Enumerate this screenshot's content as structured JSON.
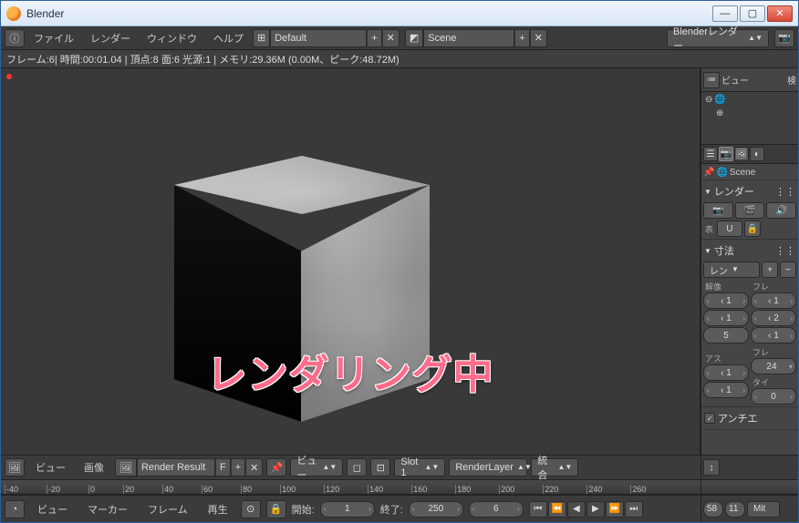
{
  "window": {
    "title": "Blender"
  },
  "menubar": {
    "items": [
      "ファイル",
      "レンダー",
      "ウィンドウ",
      "ヘルプ"
    ],
    "layout_field": "Default",
    "scene_field": "Scene",
    "engine": "Blenderレンダー"
  },
  "info_strip": "フレーム:6| 時間:00:01.04 | 頂点:8 面:6 光源:1 | メモリ:29.36M (0.00M、ピーク:48.72M)",
  "overlay": "レンダリング中",
  "image_editor": {
    "view": "ビュー",
    "image": "画像",
    "result": "Render Result",
    "f": "F",
    "view2": "ビュー",
    "slot": "Slot 1",
    "layer": "RenderLayer",
    "pass": "統合"
  },
  "ruler_ticks": [
    "-40",
    "-20",
    "0",
    "20",
    "40",
    "60",
    "80",
    "100",
    "120",
    "140",
    "160",
    "180",
    "200",
    "220",
    "240",
    "260"
  ],
  "timeline": {
    "view": "ビュー",
    "marker": "マーカー",
    "frame": "フレーム",
    "play": "再生",
    "start_lbl": "開始:",
    "start": "1",
    "end_lbl": "終了:",
    "end": "250",
    "current": "6",
    "right_numbers": [
      "58",
      "11"
    ],
    "right_label": "Mit"
  },
  "outliner": {
    "view": "ビュー",
    "search": "検"
  },
  "properties": {
    "scene_top": "Scene",
    "sections": {
      "render": "レンダー",
      "display": "表",
      "u": "U",
      "dimensions": "寸法",
      "preset": "レン",
      "resolution_lbl": "解像",
      "frame_lbl": "フレ",
      "aspect_lbl": "アス",
      "frame2_lbl": "フレ",
      "tile_lbl": "タイ",
      "aa": "アンチエ",
      "res1": "‹ 1",
      "res2": "‹ 1",
      "res3": "5",
      "frm1": "‹ 1",
      "frm2": "‹ 2",
      "frm3": "‹ 1",
      "asp1": "‹ 1",
      "asp2": "‹ 1",
      "fps": "24",
      "tile": "0"
    }
  }
}
